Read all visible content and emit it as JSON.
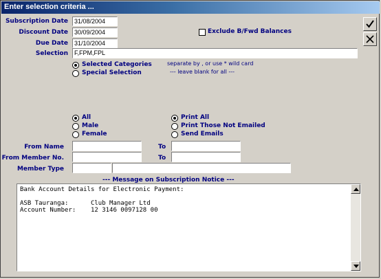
{
  "window": {
    "title": "Enter selection criteria ..."
  },
  "fields": {
    "subscription_date": {
      "label": "Subscription Date",
      "value": "31/08/2004"
    },
    "discount_date": {
      "label": "Discount Date",
      "value": "30/09/2004"
    },
    "due_date": {
      "label": "Due Date",
      "value": "31/10/2004"
    },
    "selection": {
      "label": "Selection",
      "value": "F,FPM,FPL"
    }
  },
  "exclude_bfwd": {
    "label": "Exclude B/Fwd Balances",
    "checked": false
  },
  "selection_hint": {
    "line1": "separate by , or use * wild card",
    "line2": "---   leave blank for all   ---"
  },
  "category_mode": {
    "options": [
      {
        "label": "Selected Categories",
        "selected": true
      },
      {
        "label": "Special Selection",
        "selected": false
      }
    ]
  },
  "gender": {
    "options": [
      {
        "label": "All",
        "selected": true
      },
      {
        "label": "Male",
        "selected": false
      },
      {
        "label": "Female",
        "selected": false
      }
    ]
  },
  "print_mode": {
    "options": [
      {
        "label": "Print All",
        "selected": true
      },
      {
        "label": "Print Those Not Emailed",
        "selected": false
      },
      {
        "label": "Send Emails",
        "selected": false
      }
    ]
  },
  "range": {
    "from_name": {
      "label": "From Name",
      "from": "",
      "to_label": "To",
      "to": ""
    },
    "from_member": {
      "label": "From Member No.",
      "from": "",
      "to_label": "To",
      "to": ""
    },
    "member_type": {
      "label": "Member Type",
      "code": "",
      "description": ""
    }
  },
  "message": {
    "heading": "---  Message on Subscription Notice  ---",
    "lines": [
      "Bank Account Details for Electronic Payment:",
      "",
      "ASB Tauranga:      Club Manager Ltd",
      "Account Number:    12 3146 0097128 00"
    ]
  },
  "buttons": {
    "ok": "check-icon",
    "cancel": "close-icon"
  },
  "colors": {
    "label": "#000080",
    "titlebar_start": "#0a246a",
    "titlebar_end": "#a6caf0"
  }
}
